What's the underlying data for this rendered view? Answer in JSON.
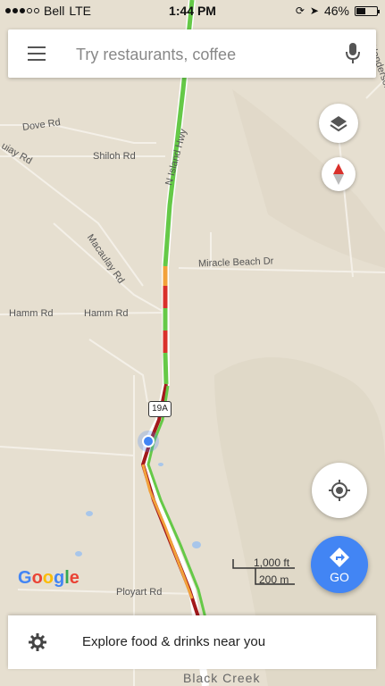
{
  "status_bar": {
    "carrier": "Bell",
    "network": "LTE",
    "time": "1:44 PM",
    "battery": "46%",
    "battery_level": 0.46
  },
  "search": {
    "placeholder": "Try restaurants, coffee"
  },
  "map": {
    "road_labels": {
      "dove": "Dove Rd",
      "shiloh": "Shiloh Rd",
      "unknown_left": "uiay Rd",
      "island_hwy": "N Island Hwy",
      "macaulay": "Macaulay Rd",
      "miracle_beach": "Miracle Beach Dr",
      "hamm_left": "Hamm Rd",
      "hamm_right": "Hamm Rd",
      "ployart": "Ployart Rd",
      "henderson": "Henderson R",
      "black_creek": "Black Creek"
    },
    "highway_shield": "19A",
    "scale": {
      "imperial": "1,000 ft",
      "metric": "200 m"
    }
  },
  "buttons": {
    "go_label": "GO"
  },
  "branding": {
    "logo": "Google"
  },
  "explore": {
    "text": "Explore food & drinks near you"
  },
  "colors": {
    "map_background": "#e6dfd0",
    "accent_blue": "#4285f4",
    "traffic_green": "#65c947",
    "traffic_orange": "#f2a13a",
    "traffic_red": "#d9302b",
    "traffic_dark_red": "#a3191c"
  },
  "icons": {
    "menu": "hamburger-menu-icon",
    "mic": "microphone-icon",
    "layers": "layers-icon",
    "compass": "compass-icon",
    "location": "my-location-icon",
    "directions": "directions-icon",
    "explore": "gear-explore-icon"
  }
}
